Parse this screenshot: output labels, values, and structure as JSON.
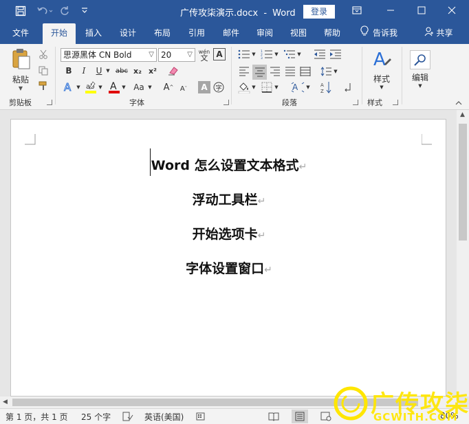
{
  "titlebar": {
    "doc_title": "广传攻柒演示.docx",
    "separator": "-",
    "app_name": "Word",
    "login_label": "登录"
  },
  "tabs": [
    "文件",
    "开始",
    "插入",
    "设计",
    "布局",
    "引用",
    "邮件",
    "审阅",
    "视图",
    "帮助",
    "告诉我",
    "共享"
  ],
  "ribbon": {
    "clipboard": {
      "paste_label": "粘贴",
      "group_label": "剪贴板"
    },
    "font": {
      "font_name": "思源黑体 CN Bold",
      "font_size": "20",
      "group_label": "字体",
      "bold": "B",
      "italic": "I",
      "underline": "U",
      "strike": "abc",
      "subscript": "x₂",
      "superscript": "x²",
      "grow": "A",
      "shrink": "A",
      "case": "Aa",
      "wen": "wén",
      "char_border": "A",
      "char_shade": "A"
    },
    "paragraph": {
      "group_label": "段落"
    },
    "styles": {
      "label": "样式",
      "group_label": "样式"
    },
    "editing": {
      "label": "编辑"
    }
  },
  "document": {
    "lines": [
      "Word 怎么设置文本格式",
      "浮动工具栏",
      "开始选项卡",
      "字体设置窗口"
    ],
    "pilcrow": "↵"
  },
  "status": {
    "page": "第 1 页，共 1 页",
    "words": "25 个字",
    "language": "英语(美国)",
    "zoom_minus": "-",
    "zoom": "80%"
  },
  "watermark": {
    "text": "广传攻柒",
    "sub": "GCWITH.COM"
  },
  "colors": {
    "accent": "#2b579a",
    "highlight": "#ffff00",
    "font_color": "#e00000"
  }
}
